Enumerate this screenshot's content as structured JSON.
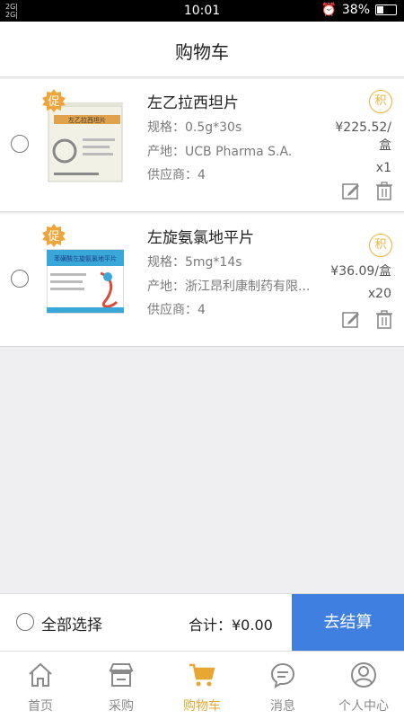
{
  "status_bar": {
    "network_line1": "2G|",
    "network_line2": "2G|",
    "time": "10:01",
    "battery": "38%"
  },
  "header": {
    "title": "购物车"
  },
  "cart_items": [
    {
      "name": "左乙拉西坦片",
      "spec": "规格：0.5g*30s",
      "origin": "产地：UCB Pharma S.A.",
      "supplier": "供应商：4",
      "promo_badge": "促",
      "points_badge": "积",
      "price_line1": "¥225.52/",
      "price_line2": "盒",
      "quantity": "x1",
      "box_label": "左乙拉西坦片",
      "box_color": "#f2f1e6"
    },
    {
      "name": "左旋氨氯地平片",
      "spec": "规格：5mg*14s",
      "origin": "产地：浙江昂利康制药有限...",
      "supplier": "供应商：4",
      "promo_badge": "促",
      "points_badge": "积",
      "price_line1": "¥36.09/盒",
      "price_line2": "",
      "quantity": "x20",
      "box_label": "苯磺酸左旋氨氯地平片",
      "box_color": "#3aa7d9"
    }
  ],
  "bottom_bar": {
    "select_all": "全部选择",
    "total": "合计：¥0.00",
    "checkout": "去结算"
  },
  "tabbar": {
    "tabs": [
      {
        "label": "首页",
        "icon": "home-icon"
      },
      {
        "label": "采购",
        "icon": "store-icon"
      },
      {
        "label": "购物车",
        "icon": "cart-icon",
        "active": true
      },
      {
        "label": "消息",
        "icon": "message-icon"
      },
      {
        "label": "个人中心",
        "icon": "person-icon"
      }
    ]
  },
  "colors": {
    "accent": "#e8a632",
    "checkout_blue": "#3e7fe0",
    "edit_gray": "#8a8a8a"
  }
}
